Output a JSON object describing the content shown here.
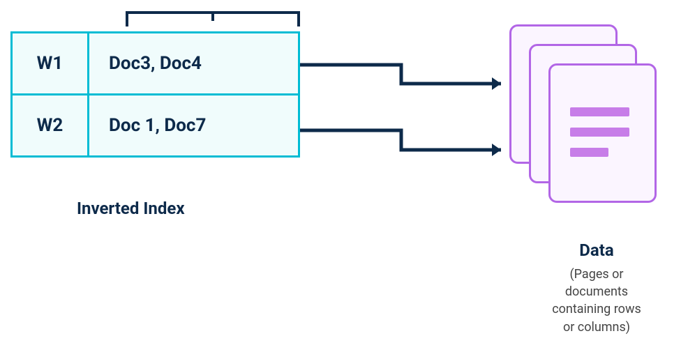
{
  "index": {
    "label": "Inverted Index",
    "rows": [
      {
        "key": "W1",
        "docs": "Doc3, Doc4"
      },
      {
        "key": "W2",
        "docs": "Doc 1, Doc7"
      }
    ]
  },
  "data": {
    "title": "Data",
    "subtitle_line1": "(Pages or documents",
    "subtitle_line2": "containing rows",
    "subtitle_line3": "or columns)"
  },
  "colors": {
    "table_border": "#00bcd4",
    "table_bg": "#f0fcfc",
    "text": "#0d2a4a",
    "doc_border": "#b266e6",
    "doc_bg": "#fbf5ff",
    "doc_line": "#c77de8"
  }
}
